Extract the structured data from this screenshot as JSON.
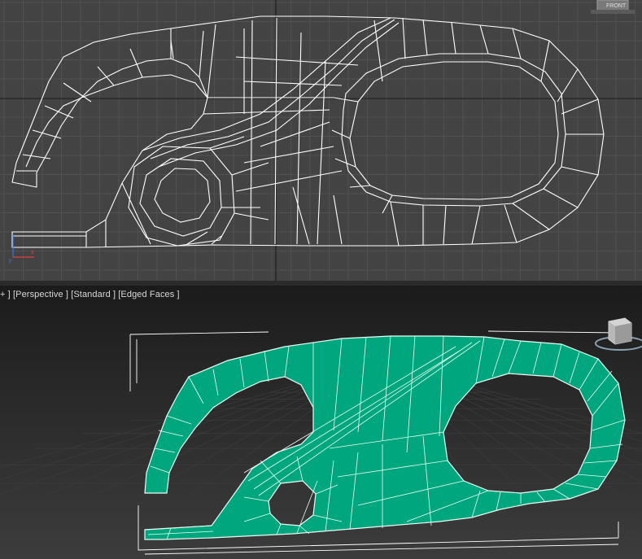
{
  "viewports": {
    "top": {
      "name": "Front/Top orthographic wireframe viewport",
      "viewcube_label": "FRONT"
    },
    "bottom": {
      "label_parts": [
        "+ ]",
        "[Perspective ]",
        "[Standard ]",
        "[Edged Faces ]"
      ],
      "viewcube_label": ""
    }
  },
  "colors": {
    "viewport_top_bg": "#434343",
    "grid": "#5a5a5a",
    "wire": "#ffffff",
    "mesh_fill": "#00a67e",
    "mesh_edge": "#e8fff6",
    "axis_x": "#e04040",
    "axis_y": "#3a6fe0"
  }
}
